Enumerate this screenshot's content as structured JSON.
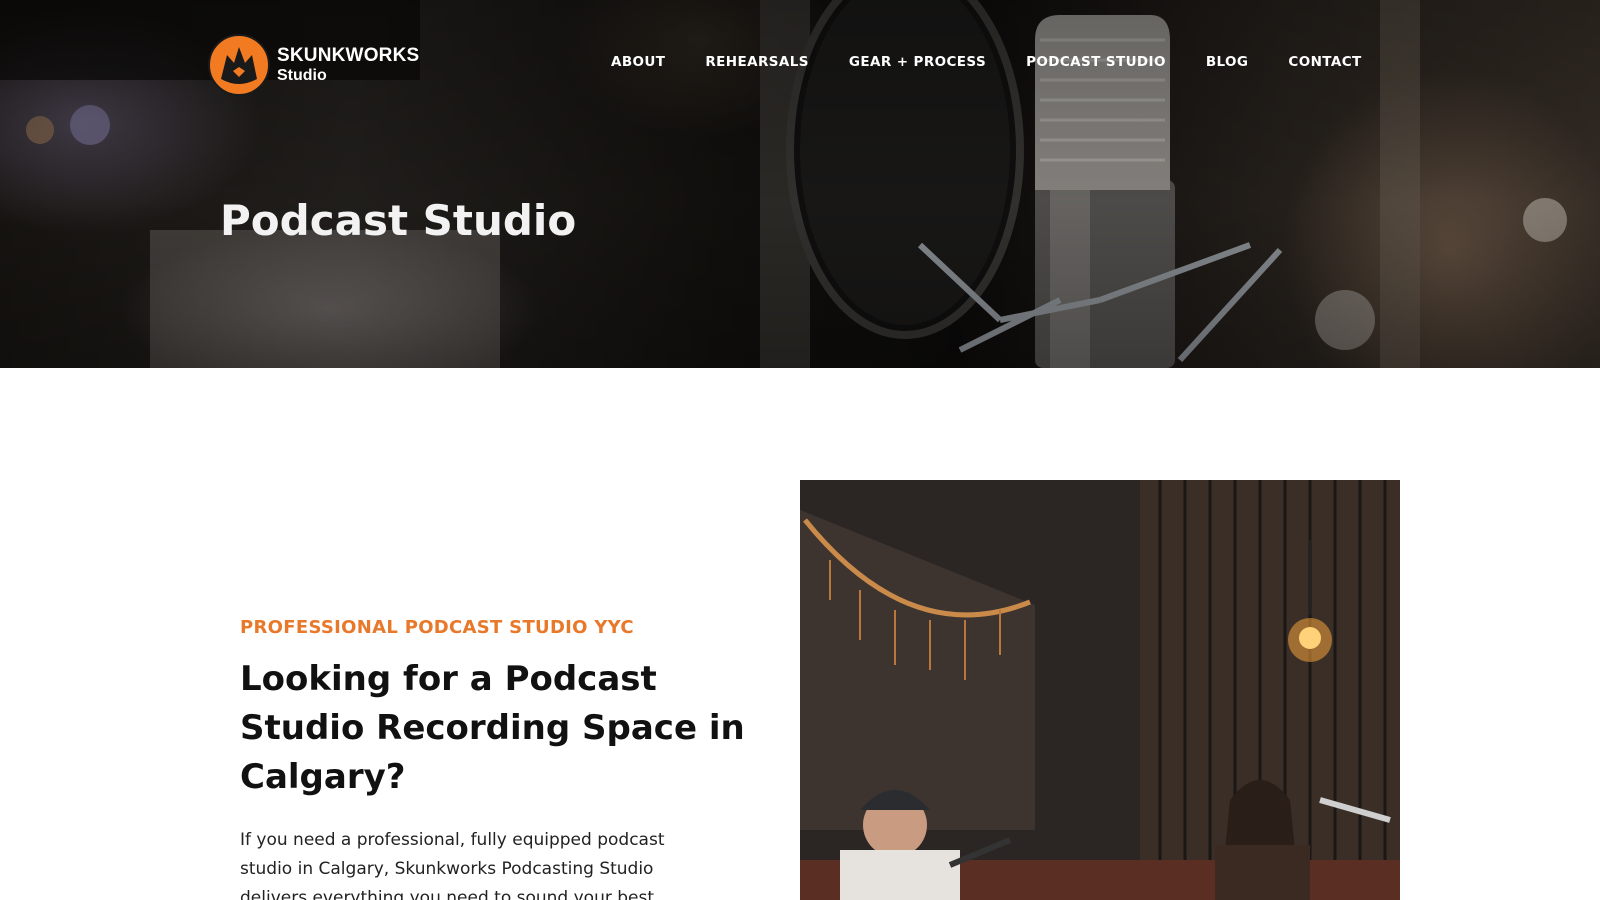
{
  "brand": {
    "name_line1": "SKUNKWORKS",
    "name_line2": "Studio",
    "accent_color": "#e8782a"
  },
  "nav": {
    "items": [
      {
        "label": "ABOUT"
      },
      {
        "label": "REHEARSALS"
      },
      {
        "label": "GEAR + PROCESS"
      },
      {
        "label": "PODCAST STUDIO"
      },
      {
        "label": "BLOG"
      },
      {
        "label": "CONTACT"
      }
    ]
  },
  "hero": {
    "title": "Podcast Studio",
    "background_image": "microphone-with-pop-filter"
  },
  "intro": {
    "eyebrow": "PROFESSIONAL PODCAST STUDIO YYC",
    "headline": "Looking for a Podcast Studio Recording Space in Calgary?",
    "body": "If you need a professional, fully equipped podcast studio in Calgary, Skunkworks Podcasting Studio delivers everything you need to sound your best"
  },
  "photo": {
    "subject": "two-hosts-recording-podcast"
  }
}
